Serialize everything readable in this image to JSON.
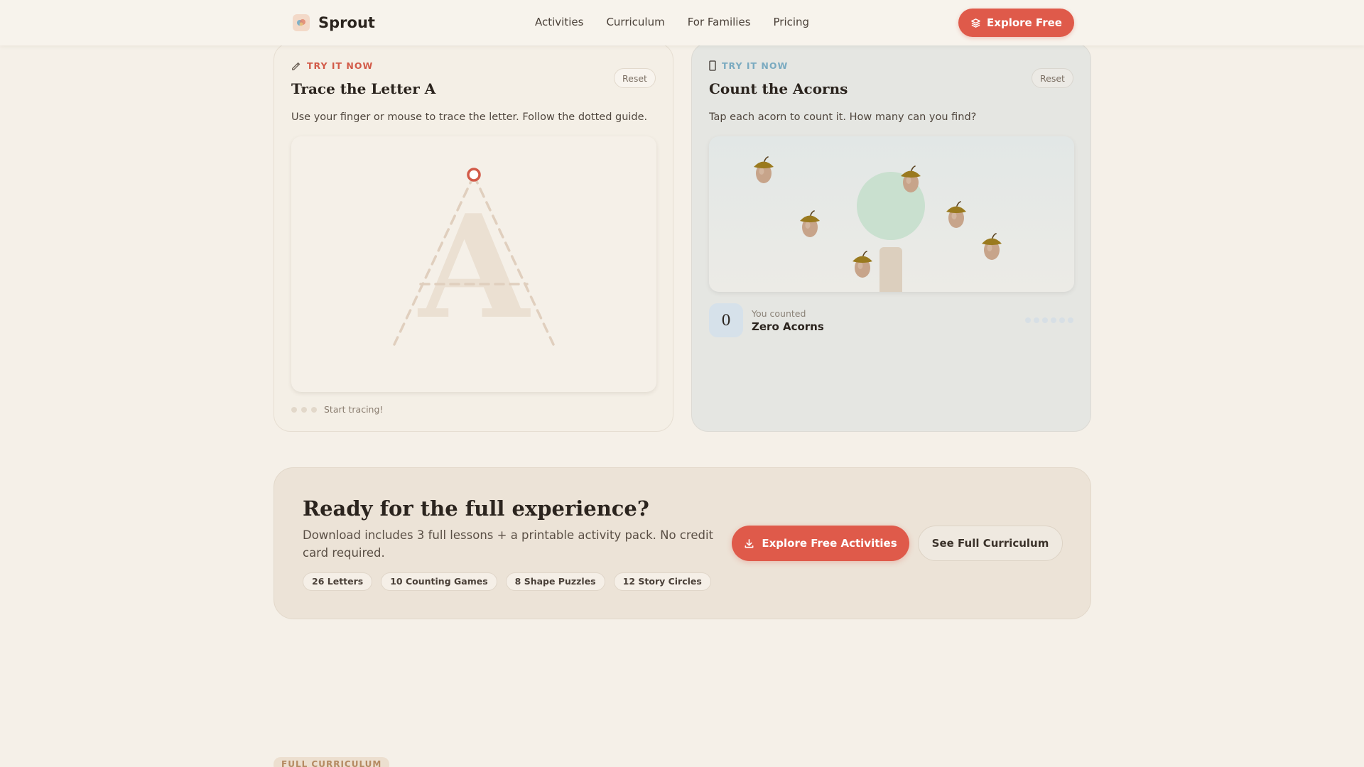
{
  "header": {
    "brand": "Sprout",
    "nav": [
      "Activities",
      "Curriculum",
      "For Families",
      "Pricing"
    ],
    "cta_label": "Explore Free"
  },
  "trace_card": {
    "eyebrow": "TRY IT NOW",
    "title": "Trace the Letter A",
    "reset_label": "Reset",
    "description": "Use your finger or mouse to trace the letter. Follow the dotted guide.",
    "letter": "A",
    "status": "Start tracing!",
    "accent_color": "#d25a48"
  },
  "count_card": {
    "eyebrow": "TRY IT NOW",
    "title": "Count the Acorns",
    "reset_label": "Reset",
    "description": "Tap each acorn to count it. How many can you find?",
    "count_number": "0",
    "count_label": "You counted",
    "count_value": "Zero Acorns",
    "progress_total": 6,
    "progress_filled": 0,
    "accent_color": "#7aaac0"
  },
  "cta": {
    "title": "Ready for the full experience?",
    "description": "Download includes 3 full lessons + a printable activity pack. No credit card required.",
    "chips": [
      "26 Letters",
      "10 Counting Games",
      "8 Shape Puzzles",
      "12 Story Circles"
    ],
    "primary_label": "Explore Free Activities",
    "secondary_label": "See Full Curriculum"
  },
  "section_tag": "FULL CURRICULUM",
  "colors": {
    "primary": "#df5a4a",
    "background": "#f5f0e8"
  }
}
